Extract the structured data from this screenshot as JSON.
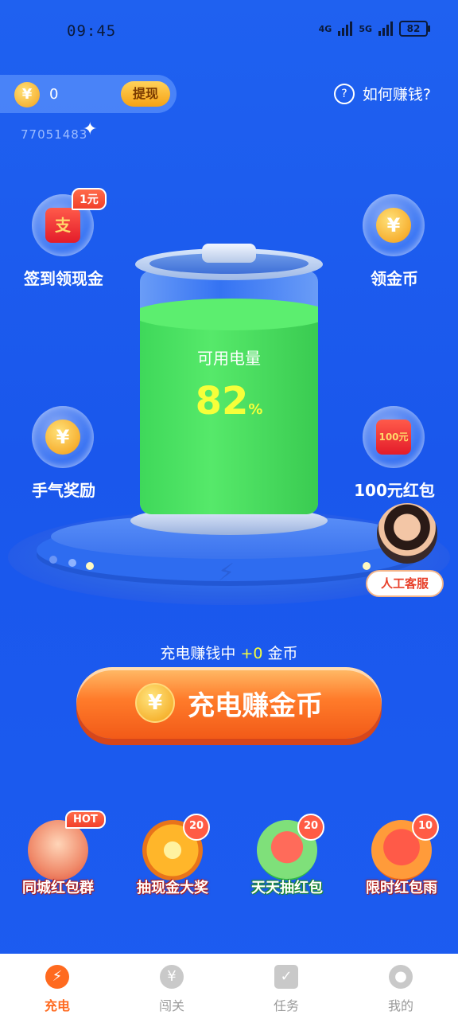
{
  "status": {
    "time": "09:45",
    "net1": "4G",
    "net2": "5G",
    "battery": "82"
  },
  "header": {
    "coin_symbol": "¥",
    "coin_balance": "0",
    "withdraw_label": "提现",
    "user_id": "77051483",
    "help_label": "如何赚钱?"
  },
  "side_items": {
    "checkin": {
      "label": "签到领现金",
      "badge": "1元",
      "icon_text": "支"
    },
    "coins": {
      "label": "领金币",
      "icon_text": "¥"
    },
    "luck": {
      "label": "手气奖励",
      "icon_text": "¥"
    },
    "redpacket": {
      "label": "100元红包",
      "icon_text": "100元"
    }
  },
  "battery": {
    "label": "可用电量",
    "percent": "82",
    "unit": "%",
    "level": 0.82
  },
  "customer_service": {
    "label": "人工客服"
  },
  "earn": {
    "prefix": "充电赚钱中",
    "amount": "+0",
    "suffix": "金币"
  },
  "main_button": {
    "label": "充电赚金币",
    "coin_symbol": "¥"
  },
  "activities": [
    {
      "label": "同城红包群",
      "badge": "HOT"
    },
    {
      "label": "抽现金大奖",
      "badge": "20"
    },
    {
      "label": "天天抽红包",
      "badge": "20"
    },
    {
      "label": "限时红包雨",
      "badge": "10"
    }
  ],
  "tabs": [
    {
      "label": "充电",
      "icon": "bolt-icon",
      "active": true
    },
    {
      "label": "闯关",
      "icon": "money-bag-icon",
      "active": false
    },
    {
      "label": "任务",
      "icon": "clipboard-icon",
      "active": false
    },
    {
      "label": "我的",
      "icon": "user-icon",
      "active": false
    }
  ],
  "colors": {
    "accent": "#ff6a1f",
    "background": "#1f61f0",
    "battery_fill": "#4ee064",
    "highlight": "#f6ff3a"
  }
}
